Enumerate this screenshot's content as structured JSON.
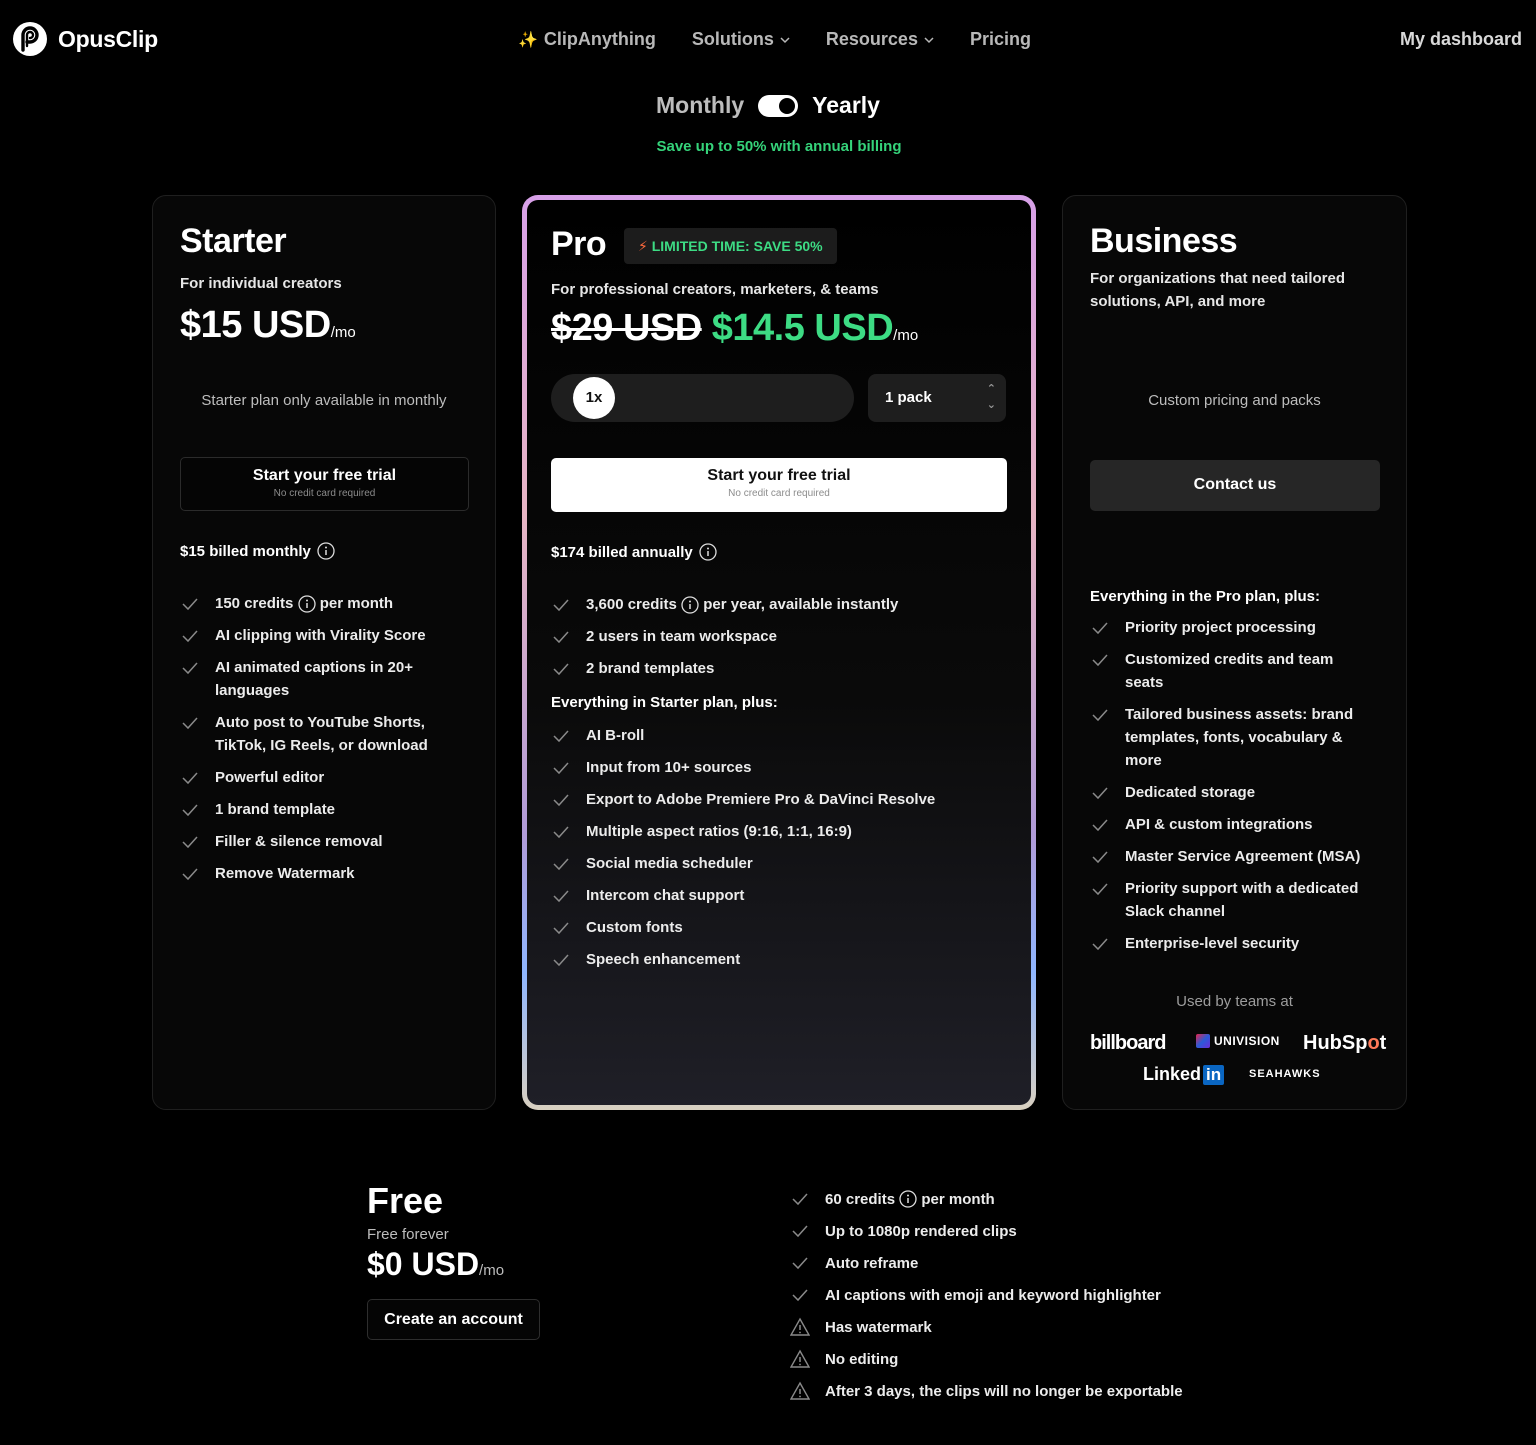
{
  "nav": {
    "brand": "OpusClip",
    "links": [
      {
        "label": "ClipAnything",
        "icon": "sparkle-icon"
      },
      {
        "label": "Solutions",
        "icon": "chevron-down-icon"
      },
      {
        "label": "Resources",
        "icon": "chevron-down-icon"
      },
      {
        "label": "Pricing"
      }
    ],
    "dashboard": "My dashboard"
  },
  "billing": {
    "monthly": "Monthly",
    "yearly": "Yearly",
    "selected": "Yearly",
    "note": "Save up to 50% with annual billing"
  },
  "starter": {
    "title": "Starter",
    "subtitle": "For individual creators",
    "price": "$15 USD",
    "per": "/mo",
    "note": "Starter plan only available in monthly",
    "cta": "Start your free trial",
    "cta_sub": "No credit card required",
    "billed": "$15 billed monthly",
    "features": [
      "150 credits",
      "per month",
      "AI clipping with Virality Score",
      "AI animated captions in 20+ languages",
      "Auto post to YouTube Shorts, TikTok, IG Reels, or download",
      "Powerful editor",
      "1 brand template",
      "Filler & silence removal",
      "Remove Watermark"
    ]
  },
  "pro": {
    "title": "Pro",
    "badge": "LIMITED TIME: SAVE 50%",
    "subtitle": "For professional creators, marketers, & teams",
    "old_price": "$29 USD",
    "price": "$14.5 USD",
    "per": "/mo",
    "multiplier": "1x",
    "pack": "1 pack",
    "cta": "Start your free trial",
    "cta_sub": "No credit card required",
    "billed": "$174 billed annually",
    "top_features": [
      "3,600 credits",
      "per year, available instantly",
      "2 users in team workspace",
      "2 brand templates"
    ],
    "plus_heading": "Everything in Starter plan, plus:",
    "features": [
      "AI B-roll",
      "Input from 10+ sources",
      "Export to Adobe Premiere Pro & DaVinci Resolve",
      "Multiple aspect ratios (9:16, 1:1, 16:9)",
      "Social media scheduler",
      "Intercom chat support",
      "Custom fonts",
      "Speech enhancement"
    ]
  },
  "business": {
    "title": "Business",
    "subtitle": "For organizations that need tailored solutions, API, and more",
    "note": "Custom pricing and packs",
    "cta": "Contact us",
    "plus_heading": "Everything in the Pro plan, plus:",
    "features": [
      "Priority project processing",
      "Customized credits and team seats",
      "Tailored business assets: brand templates, fonts, vocabulary & more",
      "Dedicated storage",
      "API & custom integrations",
      "Master Service Agreement (MSA)",
      "Priority support with a dedicated Slack channel",
      "Enterprise-level security"
    ],
    "used_by": "Used by teams at",
    "logos": {
      "billboard": "billboard",
      "univision": "UNIVISION",
      "hubspot_a": "HubSp",
      "hubspot_o": "o",
      "hubspot_b": "t",
      "linkedin": "Linked",
      "linkedin_in": "in",
      "seahawks": "SEAHAWKS"
    }
  },
  "free": {
    "title": "Free",
    "subtitle": "Free forever",
    "price": "$0 USD",
    "per": "/mo",
    "cta": "Create an account",
    "features": [
      {
        "text": "60 credits",
        "extra": "per month",
        "icon": "check-icon"
      },
      {
        "text": "Up to 1080p rendered clips",
        "icon": "check-icon"
      },
      {
        "text": "Auto reframe",
        "icon": "check-icon"
      },
      {
        "text": "AI captions with emoji and keyword highlighter",
        "icon": "check-icon"
      },
      {
        "text": "Has watermark",
        "icon": "warning-icon"
      },
      {
        "text": "No editing",
        "icon": "warning-icon"
      },
      {
        "text": "After 3 days, the clips will no longer be exportable",
        "icon": "warning-icon"
      }
    ]
  },
  "colors": {
    "accent_green": "#3ddc84",
    "background": "#000000",
    "hubspot_orange": "#ff7a59",
    "linkedin_blue": "#0a66c2"
  }
}
